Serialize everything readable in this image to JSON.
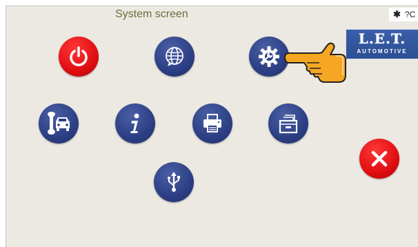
{
  "screen": {
    "title": "System screen",
    "status_text": "?C"
  },
  "logo": {
    "main": "L.E.T.",
    "sub": "AUTOMOTIVE"
  },
  "buttons": [
    {
      "name": "power-button",
      "icon": "power-icon",
      "color": "#e00e12"
    },
    {
      "name": "language-button",
      "icon": "globe-icon",
      "color": "#2c3f84"
    },
    {
      "name": "settings-button",
      "icon": "gear-wrench-icon",
      "color": "#2c3f84"
    },
    {
      "name": "vehicle-service-button",
      "icon": "car-wrench-icon",
      "color": "#2c3f84"
    },
    {
      "name": "info-button",
      "icon": "info-icon",
      "color": "#2c3f84"
    },
    {
      "name": "printer-button",
      "icon": "printer-icon",
      "color": "#2c3f84"
    },
    {
      "name": "archive-button",
      "icon": "archive-box-icon",
      "color": "#2c3f84"
    },
    {
      "name": "usb-button",
      "icon": "usb-icon",
      "color": "#2c3f84"
    },
    {
      "name": "close-button",
      "icon": "close-x-icon",
      "color": "#e00e12"
    }
  ],
  "pointer": {
    "icon": "pointing-hand-icon",
    "color": "#f5a623"
  }
}
